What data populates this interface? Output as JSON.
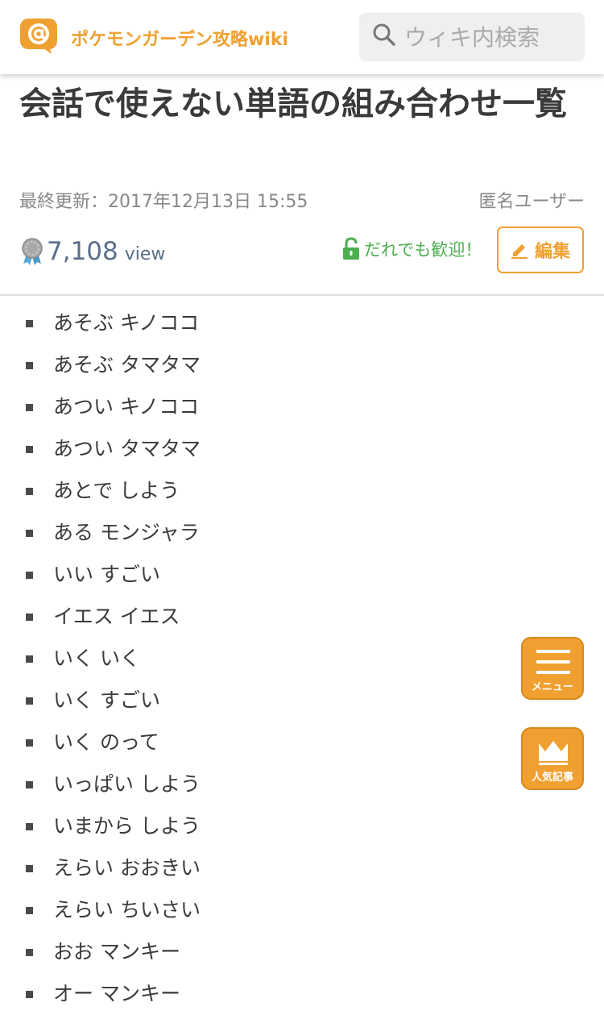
{
  "header": {
    "site_title": "ポケモンガーデン攻略wiki",
    "search_placeholder": "ウィキ内検索"
  },
  "article": {
    "title": "会話で使えない単語の組み合わせ一覧",
    "updated": "最終更新：2017年12月13日 15:55",
    "author": "匿名ユーザー",
    "view_count": "7,108",
    "view_unit": "view",
    "welcome_text": "だれでも歓迎！",
    "edit_label": "編集"
  },
  "words": [
    "あそぶ キノココ",
    "あそぶ タマタマ",
    "あつい キノココ",
    "あつい タマタマ",
    "あとで しよう",
    "ある モンジャラ",
    "いい すごい",
    "イエス イエス",
    "いく いく",
    "いく すごい",
    "いく のって",
    "いっぱい しよう",
    "いまから しよう",
    "えらい おおきい",
    "えらい ちいさい",
    "おお マンキー",
    "オー マンキー"
  ],
  "floating": {
    "menu_label": "メニュー",
    "popular_label": "人気記事"
  },
  "colors": {
    "accent": "#f0a030",
    "welcome": "#4caf50",
    "views": "#5a6f8a"
  },
  "icons": {
    "logo": "at-sign-bubble-icon",
    "search": "search-icon",
    "medal": "medal-icon",
    "lock": "unlock-icon",
    "edit": "pencil-icon",
    "menu": "hamburger-icon",
    "popular": "crown-icon"
  }
}
